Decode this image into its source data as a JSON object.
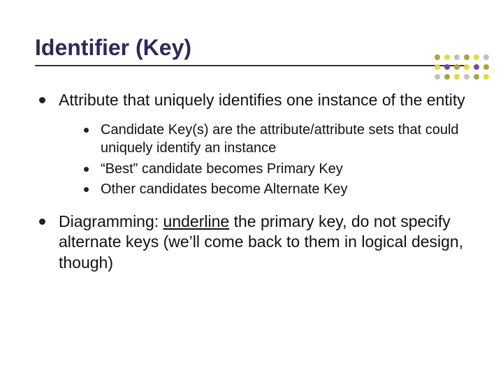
{
  "title": "Identifier (Key)",
  "bullets": {
    "b1": "Attribute that uniquely identifies one instance of the entity",
    "b1_sub": {
      "s1": "Candidate Key(s) are the attribute/attribute sets that could uniquely identify an instance",
      "s2": "“Best” candidate becomes Primary Key",
      "s3": "Other candidates become Alternate Key"
    },
    "b2_pre": "Diagramming: ",
    "b2_underlined": "underline",
    "b2_post": " the primary key, do not specify alternate keys (we’ll come back to them in logical design, though)"
  },
  "deco_colors": {
    "olive": "#a8a838",
    "yellow": "#e8d83e",
    "gray": "#c0c0c0",
    "purple": "#7a4a9a"
  }
}
